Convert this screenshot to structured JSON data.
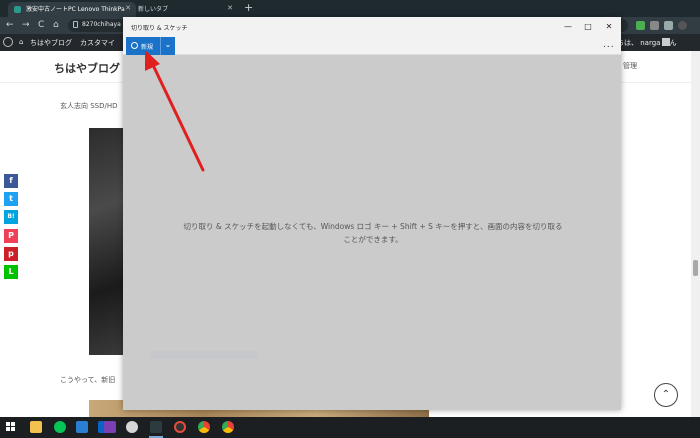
{
  "browser": {
    "tabs": [
      {
        "title": "激安中古ノートPC Lenovo ThinkPa",
        "active": true
      },
      {
        "title": "新しいタブ",
        "active": false
      }
    ],
    "new_tab": "+",
    "url": "8270chihaya",
    "icons": {
      "back": "←",
      "forward": "→",
      "reload": "C",
      "home": "⌂"
    }
  },
  "admin_bar": {
    "site_name": "ちはやブログ",
    "customize": "カスタマイ",
    "greeting": "こんにちは、 narga さん"
  },
  "blog": {
    "title": "ちはやブログ",
    "manage": "管理",
    "text1": "玄人志向 SSD/HD",
    "text2": "こうやって、新旧",
    "share": [
      "f",
      "t",
      "B!",
      "P",
      "p",
      "L"
    ]
  },
  "snip": {
    "title": "切り取り & スケッチ",
    "new_label": "新規",
    "more": "...",
    "hint_line1": "切り取り & スケッチを起動しなくても、Windows ロゴ キー + Shift + S キーを押すと、画面の内容を切り取る",
    "hint_line2": "ことができます。",
    "window_buttons": {
      "minimize": "—",
      "maximize": "□",
      "close": "✕"
    }
  },
  "colors": {
    "accent": "#1a73c9",
    "arrow": "#e0201e"
  }
}
